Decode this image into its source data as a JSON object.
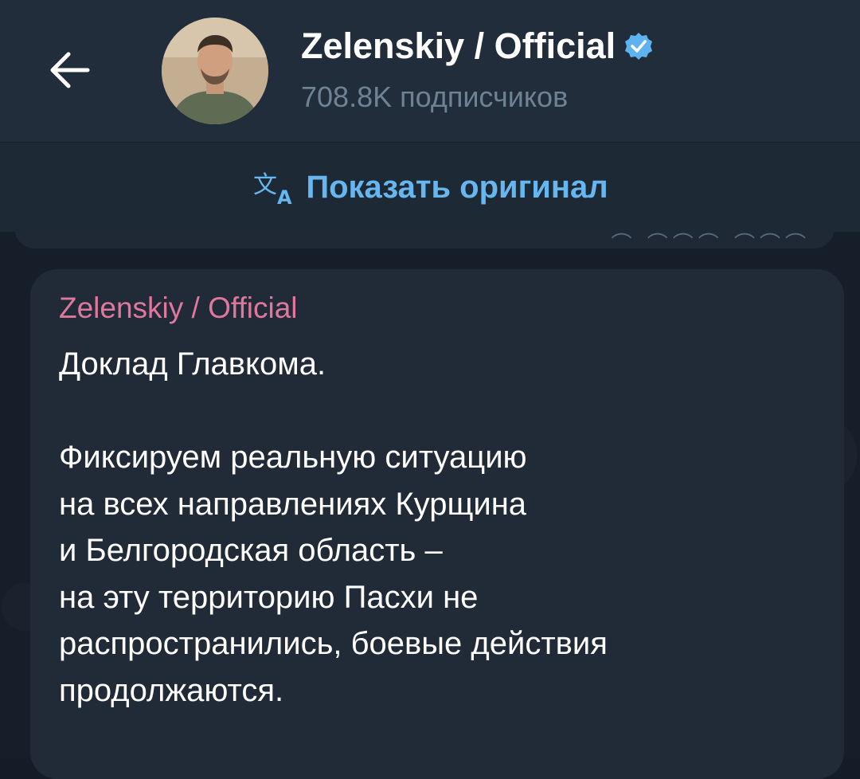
{
  "header": {
    "back_icon": "arrow-left-icon",
    "avatar_icon": "channel-avatar-photo",
    "title": "Zelenskiy / Official",
    "verified_icon": "verified-check-icon",
    "verified_color": "#5db3ef",
    "subtitle": "708.8K подписчиков"
  },
  "translate_bar": {
    "icon": "translate-icon",
    "label": "Показать оригинал",
    "accent_color": "#66b6f0"
  },
  "message": {
    "forwarded_from": "Zelenskiy / Official",
    "forwarded_color": "#e0789d",
    "text": "Доклад Главкома.\n\nФиксируем реальную ситуацию\nна всех направлениях Курщина\nи Белгородская область –\nна эту территорию Пасхи не\nраспространились, боевые действия\nпродолжаются."
  }
}
